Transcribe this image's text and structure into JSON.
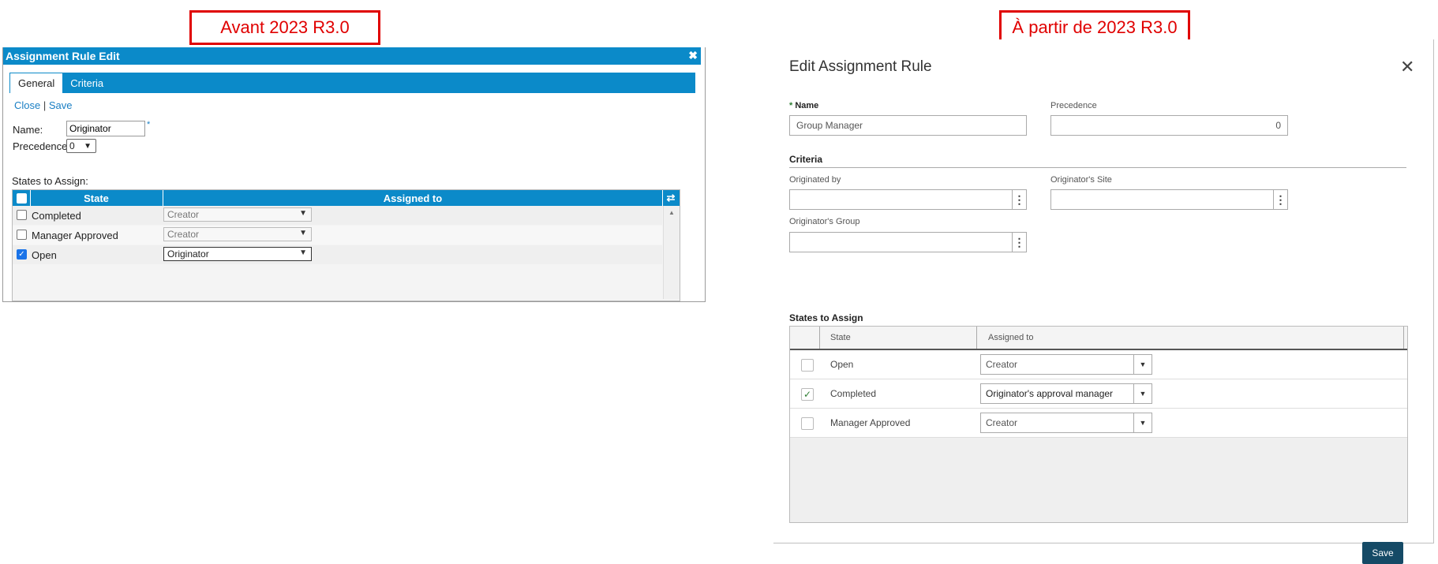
{
  "captions": {
    "before": "Avant 2023 R3.0",
    "after": "À partir de 2023 R3.0"
  },
  "old_dialog": {
    "title": "Assignment Rule Edit",
    "close_glyph": "✖",
    "tabs": [
      "General",
      "Criteria"
    ],
    "links": {
      "close": "Close",
      "separator": "|",
      "save": "Save"
    },
    "name_label": "Name:",
    "name_value": "Originator",
    "required_mark": "*",
    "precedence_label": "Precedence:",
    "precedence_value": "0",
    "states_label": "States to Assign:",
    "grid": {
      "columns": [
        "State",
        "Assigned to"
      ],
      "rows": [
        {
          "checked": false,
          "state": "Completed",
          "assigned": "Creator",
          "active": false
        },
        {
          "checked": false,
          "state": "Manager Approved",
          "assigned": "Creator",
          "active": false
        },
        {
          "checked": true,
          "state": "Open",
          "assigned": "Originator",
          "active": true
        }
      ]
    }
  },
  "new_dialog": {
    "title": "Edit Assignment Rule",
    "close_glyph": "✕",
    "name_label": "Name",
    "name_required": "*",
    "name_value": "Group Manager",
    "precedence_label": "Precedence",
    "precedence_value": "0",
    "criteria_heading": "Criteria",
    "originated_by_label": "Originated by",
    "originators_site_label": "Originator's Site",
    "originators_group_label": "Originator's Group",
    "states_heading": "States to Assign",
    "grid": {
      "columns": [
        "State",
        "Assigned to"
      ],
      "rows": [
        {
          "checked": false,
          "state": "Open",
          "assigned": "Creator"
        },
        {
          "checked": true,
          "state": "Completed",
          "assigned": "Originator's approval manager"
        },
        {
          "checked": false,
          "state": "Manager Approved",
          "assigned": "Creator"
        }
      ]
    },
    "save_label": "Save"
  }
}
